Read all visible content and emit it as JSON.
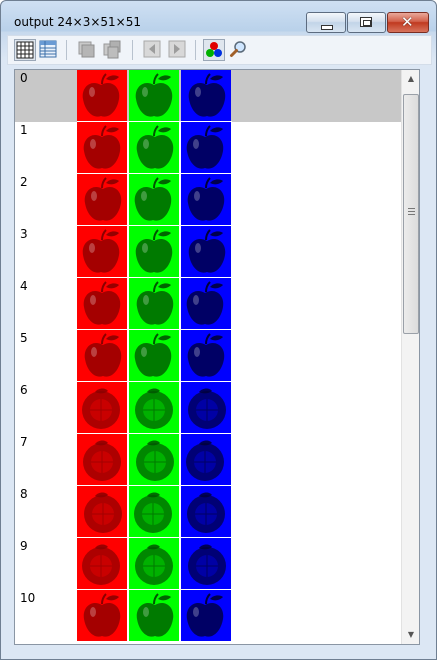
{
  "window": {
    "title": "output 24×3×51×51"
  },
  "toolbar": {
    "buttons": [
      {
        "name": "grid-view-icon",
        "selected": true
      },
      {
        "name": "table-view-icon",
        "selected": false
      },
      {
        "name": "stack-icon",
        "selected": false
      },
      {
        "name": "stack-multi-icon",
        "selected": false
      },
      {
        "name": "previous-icon",
        "selected": false
      },
      {
        "name": "next-icon",
        "selected": false
      },
      {
        "name": "rgb-channels-icon",
        "selected": true
      },
      {
        "name": "zoom-icon",
        "selected": false
      }
    ]
  },
  "rows": [
    {
      "label": "0",
      "fruit": "apple",
      "selected": true
    },
    {
      "label": "1",
      "fruit": "apple",
      "selected": false
    },
    {
      "label": "2",
      "fruit": "apple",
      "selected": false
    },
    {
      "label": "3",
      "fruit": "apple",
      "selected": false
    },
    {
      "label": "4",
      "fruit": "apple",
      "selected": false
    },
    {
      "label": "5",
      "fruit": "apple",
      "selected": false
    },
    {
      "label": "6",
      "fruit": "orange",
      "selected": false
    },
    {
      "label": "7",
      "fruit": "orange",
      "selected": false
    },
    {
      "label": "8",
      "fruit": "orange",
      "selected": false
    },
    {
      "label": "9",
      "fruit": "orange",
      "selected": false
    },
    {
      "label": "10",
      "fruit": "apple",
      "selected": false
    }
  ],
  "channels": [
    {
      "name": "red",
      "color": "#ff0000",
      "dark": "#8a0000"
    },
    {
      "name": "green",
      "color": "#00ff00",
      "dark": "#005400"
    },
    {
      "name": "blue",
      "color": "#0000ff",
      "dark": "#00003a"
    }
  ]
}
